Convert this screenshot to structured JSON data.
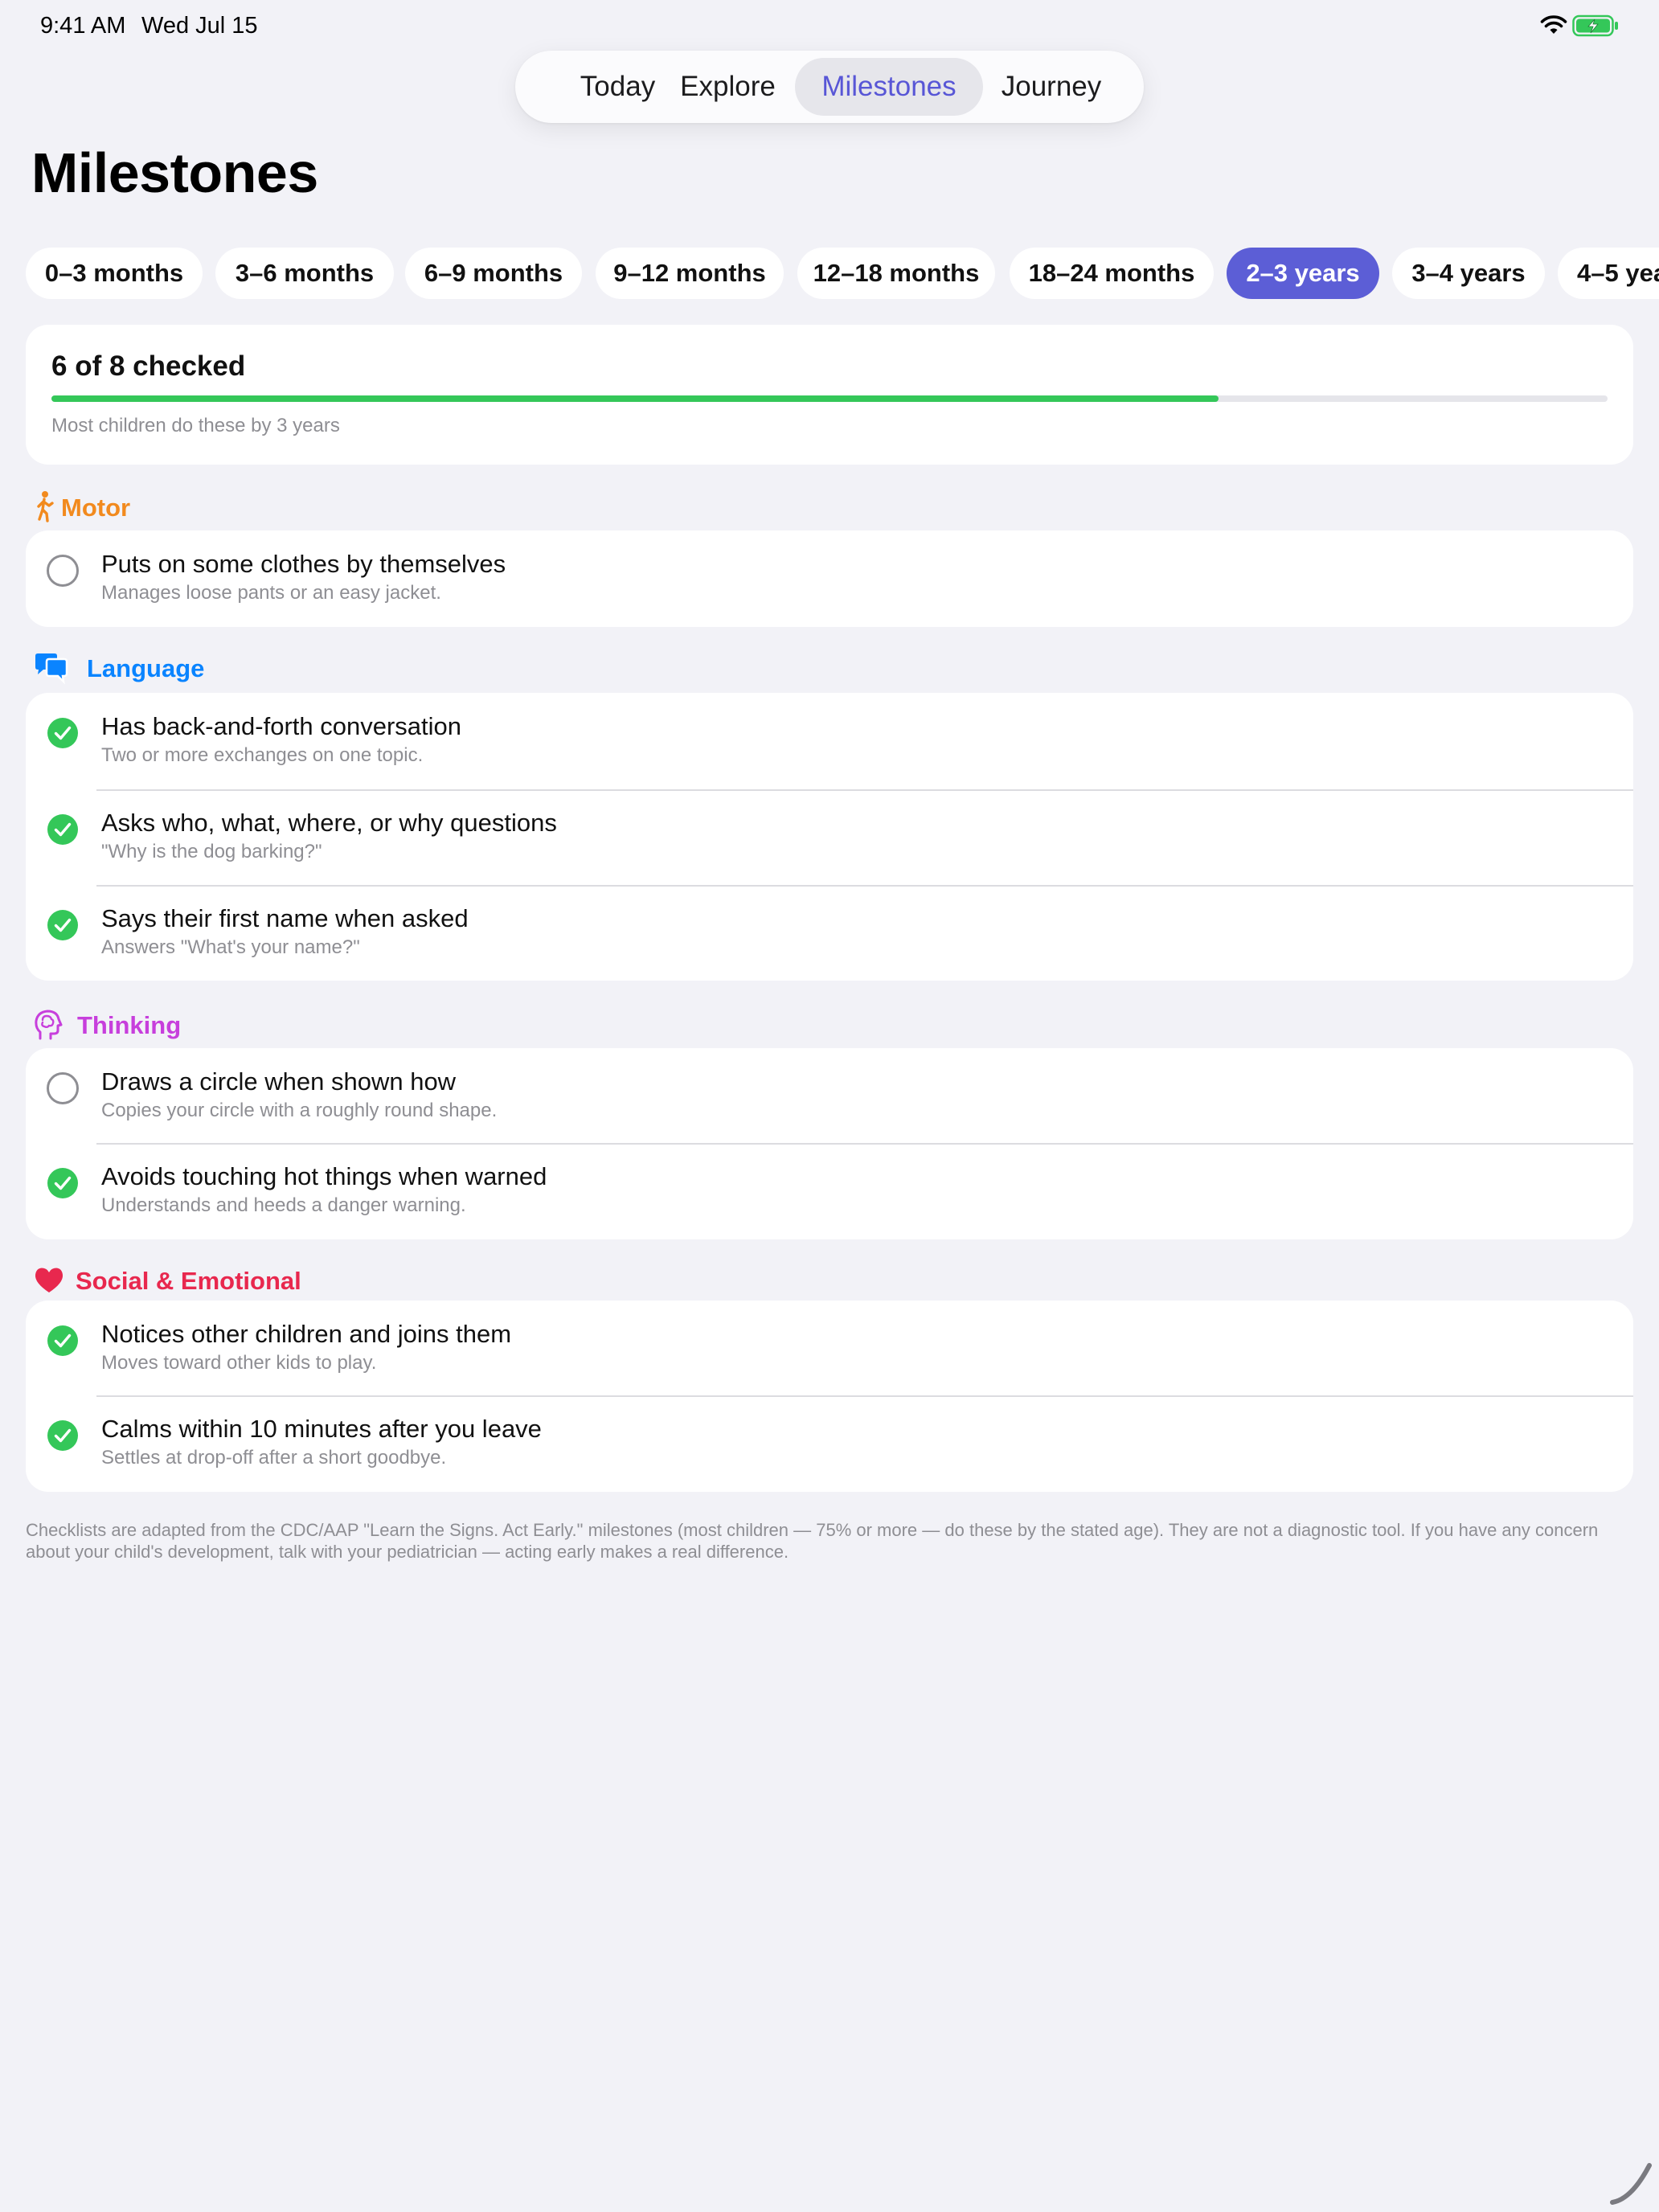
{
  "status_bar": {
    "time": "9:41 AM",
    "date": "Wed Jul 15"
  },
  "nav": {
    "tabs": [
      {
        "label": "Today",
        "active": false
      },
      {
        "label": "Explore",
        "active": false
      },
      {
        "label": "Milestones",
        "active": true
      },
      {
        "label": "Journey",
        "active": false
      }
    ]
  },
  "title": "Milestones",
  "age_ranges": [
    {
      "label": "0–3 months",
      "active": false
    },
    {
      "label": "3–6 months",
      "active": false
    },
    {
      "label": "6–9 months",
      "active": false
    },
    {
      "label": "9–12 months",
      "active": false
    },
    {
      "label": "12–18 months",
      "active": false
    },
    {
      "label": "18–24 months",
      "active": false
    },
    {
      "label": "2–3 years",
      "active": true
    },
    {
      "label": "3–4 years",
      "active": false
    },
    {
      "label": "4–5 years",
      "active": false
    }
  ],
  "progress": {
    "label": "6 of 8 checked",
    "checked": 6,
    "total": 8,
    "fraction": 0.75,
    "subtitle": "Most children do these by 3 years"
  },
  "sections": [
    {
      "name": "Motor",
      "icon": "walking-figure-icon",
      "color": "#f28a1e",
      "items": [
        {
          "title": "Puts on some clothes by themselves",
          "detail": "Manages loose pants or an easy jacket.",
          "checked": false
        }
      ]
    },
    {
      "name": "Language",
      "icon": "speech-bubbles-icon",
      "color": "#0a84ff",
      "items": [
        {
          "title": "Has back-and-forth conversation",
          "detail": "Two or more exchanges on one topic.",
          "checked": true
        },
        {
          "title": "Asks who, what, where, or why questions",
          "detail": "\"Why is the dog barking?\"",
          "checked": true
        },
        {
          "title": "Says their first name when asked",
          "detail": "Answers \"What's your name?\"",
          "checked": true
        }
      ]
    },
    {
      "name": "Thinking",
      "icon": "head-brain-icon",
      "color": "#c73fdc",
      "items": [
        {
          "title": "Draws a circle when shown how",
          "detail": "Copies your circle with a roughly round shape.",
          "checked": false
        },
        {
          "title": "Avoids touching hot things when warned",
          "detail": "Understands and heeds a danger warning.",
          "checked": true
        }
      ]
    },
    {
      "name": "Social & Emotional",
      "icon": "heart-icon",
      "color": "#e8284e",
      "items": [
        {
          "title": "Notices other children and joins them",
          "detail": "Moves toward other kids to play.",
          "checked": true
        },
        {
          "title": "Calms within 10 minutes after you leave",
          "detail": "Settles at drop-off after a short goodbye.",
          "checked": true
        }
      ]
    }
  ],
  "footnote": "Checklists are adapted from the CDC/AAP \"Learn the Signs. Act Early.\" milestones (most children — 75% or more — do these by the stated age). They are not a diagnostic tool. If you have any concern about your child's development, talk with your pediatrician — acting early makes a real difference.",
  "colors": {
    "accent": "#5c5ed6",
    "check_green": "#34c759",
    "background": "#f2f2f7"
  }
}
